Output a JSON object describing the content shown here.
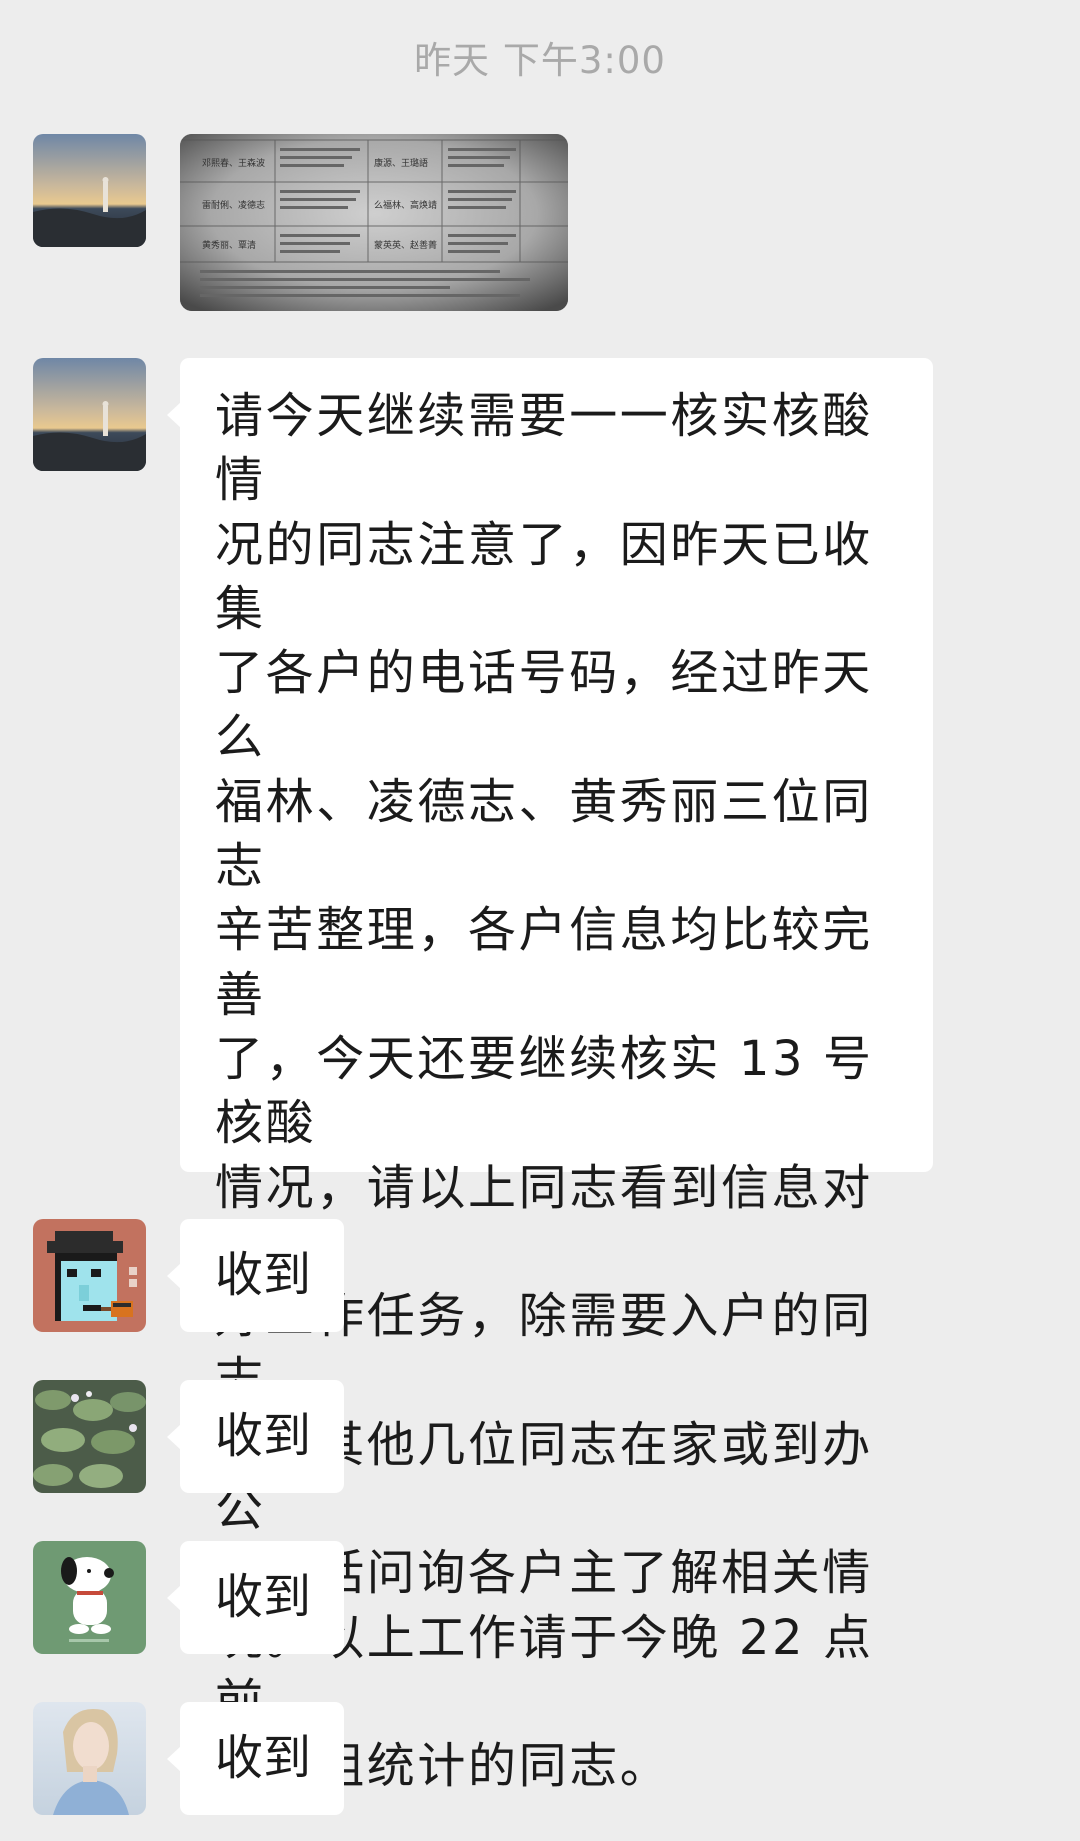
{
  "chat": {
    "timestamp": "昨天 下午3:00",
    "messages": [
      {
        "type": "image",
        "avatar": "sunset-silhouette-avatar",
        "table_rows": [
          {
            "c1": "邓熙春、王森波",
            "c2": "康源、王璐語"
          },
          {
            "c1": "雷耐俐、凌德志",
            "c2": "么福林、高焕靖"
          },
          {
            "c1": "黄秀丽、覃清",
            "c2": "蒙英英、赵善菁"
          }
        ]
      },
      {
        "type": "text",
        "avatar": "sunset-silhouette-avatar",
        "lines": [
          "请今天继续需要一一核实核酸情",
          "况的同志注意了，因昨天已收集",
          "了各户的电话号码，经过昨天么",
          "福林、凌德志、黄秀丽三位同志",
          "辛苦整理，各户信息均比较完善",
          "了，今天还要继续核实 13 号核酸",
          "情况，请以上同志看到信息对接",
          "好工作任务，除需要入户的同志",
          "外，其他几位同志在家或到办公",
          "室电话问询各户主了解相关情",
          "况。以上工作请于今晚 22 点前",
          "报各组统计的同志。"
        ]
      },
      {
        "type": "text",
        "avatar": "pixel-punk-avatar",
        "text": "收到"
      },
      {
        "type": "text",
        "avatar": "lotus-pond-avatar",
        "text": "收到"
      },
      {
        "type": "text",
        "avatar": "snoopy-avatar",
        "text": "收到"
      },
      {
        "type": "text",
        "avatar": "blonde-woman-avatar",
        "text": "收到"
      }
    ]
  },
  "colors": {
    "background": "#ededed",
    "bubble": "#ffffff",
    "text": "#1b1b1b",
    "timestamp": "#a9a9a9"
  }
}
